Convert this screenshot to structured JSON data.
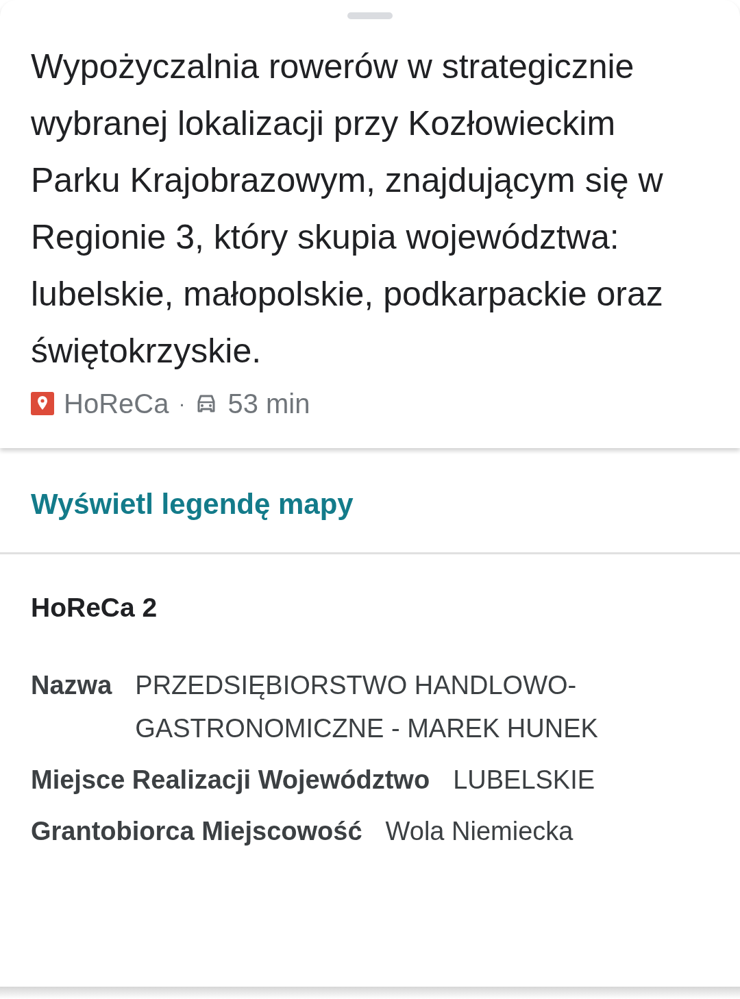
{
  "description": "Wypożyczalnia rowerów w strategicznie wybranej lokalizacji przy Kozłowieckim Parku Krajobrazowym, znajdującym się w Regionie 3, który skupia województwa: lubelskie, małopolskie, podkarpackie oraz świętokrzyskie.",
  "meta": {
    "category": "HoReCa",
    "separator": "·",
    "travel_time": "53 min"
  },
  "legend_link": "Wyświetl legendę mapy",
  "details": {
    "heading": "HoReCa 2",
    "fields": [
      {
        "label": "Nazwa",
        "value": "PRZEDSIĘBIORSTWO HANDLOWO-GASTRONOMICZNE - MAREK HUNEK"
      },
      {
        "label": "Miejsce Realizacji Województwo",
        "value": "LUBELSKIE"
      },
      {
        "label": "Grantobiorca Miejscowość",
        "value": "Wola Niemiecka"
      }
    ]
  }
}
